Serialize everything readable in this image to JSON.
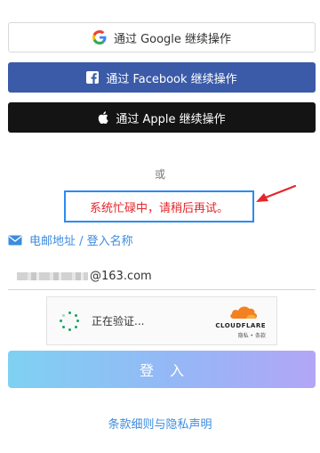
{
  "sso": {
    "google_label": "通过 Google 继续操作",
    "facebook_label": "通过 Facebook 继续操作",
    "apple_label": "通过 Apple 继续操作"
  },
  "divider_text": "或",
  "error_message": "系统忙碌中，请稍后再试。",
  "email": {
    "label": "电邮地址 / 登入名称",
    "value_suffix": "@163.com"
  },
  "captcha": {
    "status_text": "正在验证...",
    "provider_logo": "CLOUDFLARE",
    "provider_links": "隐私 • 条款"
  },
  "login_button_label": "登入",
  "terms_link": "条款细则与隐私声明",
  "colors": {
    "facebook": "#3b5ba8",
    "apple": "#141414",
    "error_text": "#e4262a",
    "error_border": "#2a8cf0",
    "link": "#3c8ce0"
  }
}
